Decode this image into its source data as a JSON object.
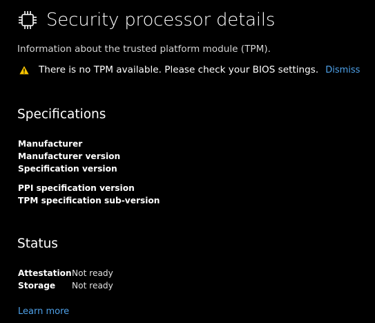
{
  "header": {
    "title": "Security processor details",
    "icon": "chip-icon"
  },
  "subtitle": "Information about the trusted platform module (TPM).",
  "warning": {
    "icon": "warning-icon",
    "message": "There is no TPM available. Please check your BIOS settings.",
    "dismiss_label": "Dismiss",
    "icon_color": "#f7c300"
  },
  "specifications": {
    "heading": "Specifications",
    "labels": [
      "Manufacturer",
      "Manufacturer version",
      "Specification version",
      "PPI specification version",
      "TPM specification sub-version"
    ]
  },
  "status": {
    "heading": "Status",
    "rows": [
      {
        "label": "Attestation",
        "value": "Not ready"
      },
      {
        "label": "Storage",
        "value": "Not ready"
      }
    ]
  },
  "learn_more_label": "Learn more",
  "colors": {
    "background": "#000000",
    "link": "#4ea1e9",
    "text": "#ffffff"
  }
}
